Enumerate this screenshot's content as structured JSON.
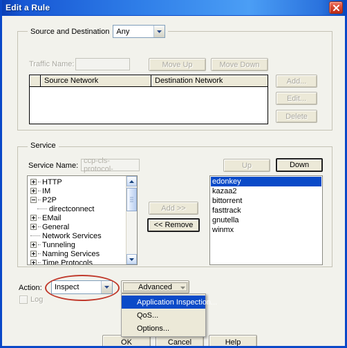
{
  "window": {
    "title": "Edit a Rule",
    "close_icon": "close-icon"
  },
  "source_destination": {
    "group_label": "Source and Destination",
    "mode_value": "Any",
    "mode_options": [
      "Any"
    ],
    "traffic_name_label": "Traffic Name:",
    "traffic_name_value": "",
    "move_up_label": "Move Up",
    "move_down_label": "Move Down",
    "add_label": "Add...",
    "edit_label": "Edit...",
    "delete_label": "Delete",
    "table": {
      "columns": [
        "",
        "Source Network",
        "Destination Network"
      ],
      "rows": []
    }
  },
  "service": {
    "group_label": "Service",
    "service_name_label": "Service Name:",
    "service_name_value": "ccp-cls-protocol-",
    "up_label": "Up",
    "down_label": "Down",
    "add_label": "Add >>",
    "remove_label": "<< Remove",
    "tree": [
      {
        "label": "HTTP",
        "depth": 0,
        "state": "collapsed"
      },
      {
        "label": "IM",
        "depth": 0,
        "state": "collapsed"
      },
      {
        "label": "P2P",
        "depth": 0,
        "state": "expanded"
      },
      {
        "label": "directconnect",
        "depth": 1,
        "state": "leaf"
      },
      {
        "label": "EMail",
        "depth": 0,
        "state": "collapsed"
      },
      {
        "label": "General",
        "depth": 0,
        "state": "collapsed"
      },
      {
        "label": "Network Services",
        "depth": 0,
        "state": "leaf"
      },
      {
        "label": "Tunneling",
        "depth": 0,
        "state": "collapsed"
      },
      {
        "label": "Naming Services",
        "depth": 0,
        "state": "collapsed"
      },
      {
        "label": "Time Protocols",
        "depth": 0,
        "state": "collapsed"
      }
    ],
    "selected_services": [
      {
        "label": "edonkey",
        "selected": true
      },
      {
        "label": "kazaa2",
        "selected": false
      },
      {
        "label": "bittorrent",
        "selected": false
      },
      {
        "label": "fasttrack",
        "selected": false
      },
      {
        "label": "gnutella",
        "selected": false
      },
      {
        "label": "winmx",
        "selected": false
      }
    ]
  },
  "action": {
    "label": "Action:",
    "value": "Inspect",
    "options": [
      "Inspect"
    ],
    "log_label": "Log",
    "log_checked": false,
    "advanced_label": "Advanced",
    "menu": [
      {
        "label": "Application Inspection...",
        "highlighted": true
      },
      {
        "label": "QoS...",
        "highlighted": false
      },
      {
        "label": "Options...",
        "highlighted": false
      }
    ]
  },
  "footer": {
    "ok_label": "OK",
    "cancel_label": "Cancel",
    "help_label": "Help"
  },
  "annotation": {
    "color": "#c0392b",
    "shape": "ellipse-around-action-dropdown"
  }
}
